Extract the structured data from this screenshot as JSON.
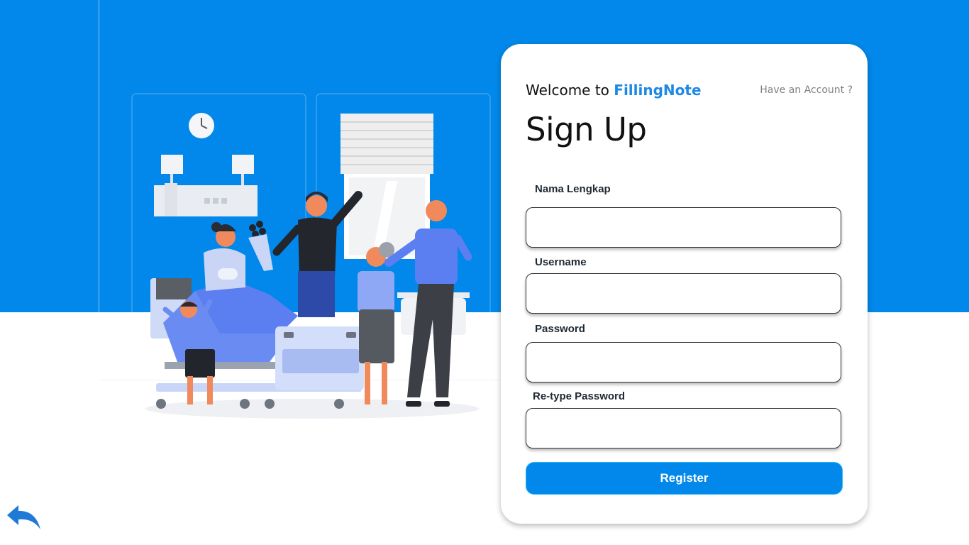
{
  "welcome": {
    "prefix": "Welcome to ",
    "brand": "FillingNote"
  },
  "have_account_link": "Have an Account ?",
  "title": "Sign Up",
  "fields": {
    "full_name": {
      "label": "Nama Lengkap",
      "value": "",
      "placeholder": ""
    },
    "username": {
      "label": "Username",
      "value": "",
      "placeholder": ""
    },
    "password": {
      "label": "Password",
      "value": "",
      "placeholder": ""
    },
    "retype_password": {
      "label": "Re-type Password",
      "value": "",
      "placeholder": ""
    }
  },
  "register_button": "Register",
  "icons": {
    "back": "undo-arrow-icon"
  },
  "colors": {
    "primary": "#0288ea",
    "brand_text": "#1e88e5",
    "illustration_accent": "#5b7ff0"
  }
}
